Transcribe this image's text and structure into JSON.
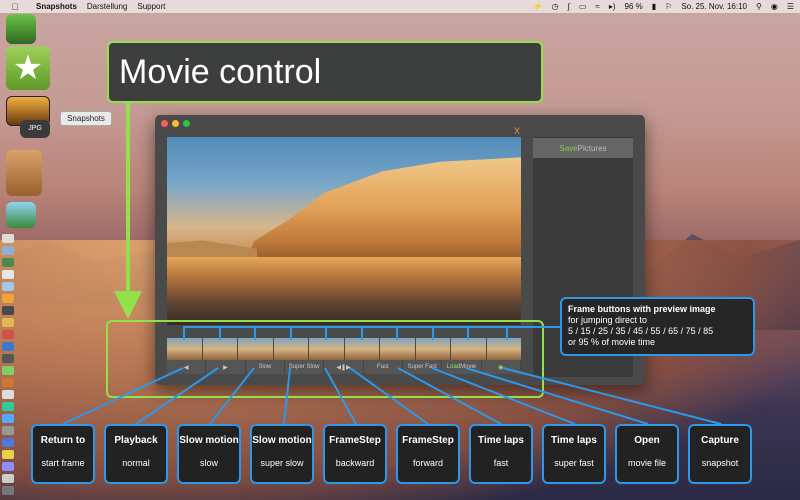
{
  "menubar": {
    "app_name": "Snapshots",
    "menus": [
      "Darstellung",
      "Support"
    ],
    "battery": "96 %",
    "datetime": "So. 25. Nov.  16:10"
  },
  "tooltip": {
    "label": "Snapshots"
  },
  "window": {
    "save_pictures_prefix": "Save",
    "save_pictures_suffix": " Pictures",
    "close_glyph": "X",
    "controls": [
      {
        "label": "",
        "icon": "return-icon"
      },
      {
        "label": "",
        "icon": "play-icon"
      },
      {
        "label": "Slow",
        "icon": ""
      },
      {
        "label": "Super Slow",
        "icon": ""
      },
      {
        "label": "",
        "icon": "framestep-icon"
      },
      {
        "label": "Fast",
        "icon": ""
      },
      {
        "label": "Super Fast",
        "icon": ""
      },
      {
        "label_prefix": "Load",
        "label": " Movie",
        "icon": ""
      },
      {
        "label": "",
        "icon": "camera-icon"
      }
    ]
  },
  "callouts": {
    "movie_control": "Movie control",
    "frame_buttons": {
      "title": "Frame buttons with preview image",
      "line1": "for jumping direct to",
      "line2": "5 / 15 / 25 / 35 / 45 / 55 / 65 / 75 / 85",
      "line3": "or 95 % of movie time"
    },
    "labels": [
      {
        "title": "Return to",
        "sub": "start frame"
      },
      {
        "title": "Playback",
        "sub": "normal"
      },
      {
        "title": "Slow motion",
        "sub": "slow"
      },
      {
        "title": "Slow motion",
        "sub": "super slow"
      },
      {
        "title": "FrameStep",
        "sub": "backward"
      },
      {
        "title": "FrameStep",
        "sub": "forward"
      },
      {
        "title": "Time laps",
        "sub": "fast"
      },
      {
        "title": "Time laps",
        "sub": "super fast"
      },
      {
        "title": "Open",
        "sub": "movie file"
      },
      {
        "title": "Capture",
        "sub": "snapshot"
      }
    ]
  },
  "colors": {
    "callout_green": "#92e14c",
    "callout_blue": "#2d98ea"
  }
}
